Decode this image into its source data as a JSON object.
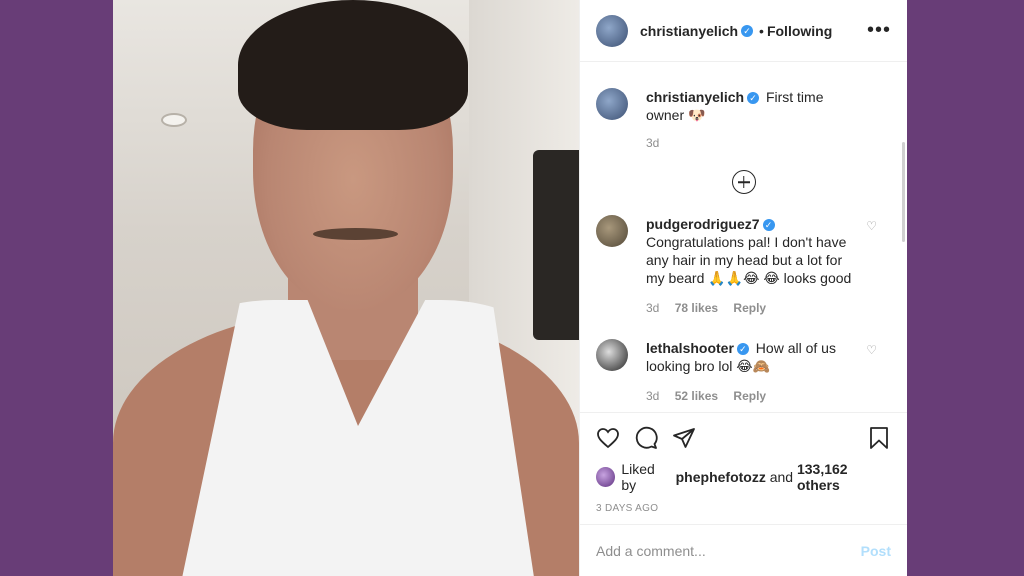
{
  "header": {
    "username": "christianyelich",
    "separator": "•",
    "follow_status": "Following",
    "more_label": "•••"
  },
  "caption": {
    "username": "christianyelich",
    "text": "First time owner 🐶",
    "time": "3d"
  },
  "comments": [
    {
      "username": "pudgerodriguez7",
      "text": "Congratulations pal! I don't have any hair in my head but a lot for my beard 🙏🙏😂 😂 looks good",
      "time": "3d",
      "likes": "78 likes",
      "reply": "Reply"
    },
    {
      "username": "lethalshooter",
      "text": "How all of us looking bro lol 😂🙈",
      "time": "3d",
      "likes": "52 likes",
      "reply": "Reply"
    }
  ],
  "likes": {
    "prefix": "Liked by",
    "user": "phephefotozz",
    "and": "and",
    "others": "133,162 others"
  },
  "date": "3 DAYS AGO",
  "add_comment": {
    "placeholder": "Add a comment...",
    "post_label": "Post"
  },
  "colors": {
    "background": "#683d77",
    "verified": "#3897f0",
    "post_button": "#b2dffc"
  }
}
